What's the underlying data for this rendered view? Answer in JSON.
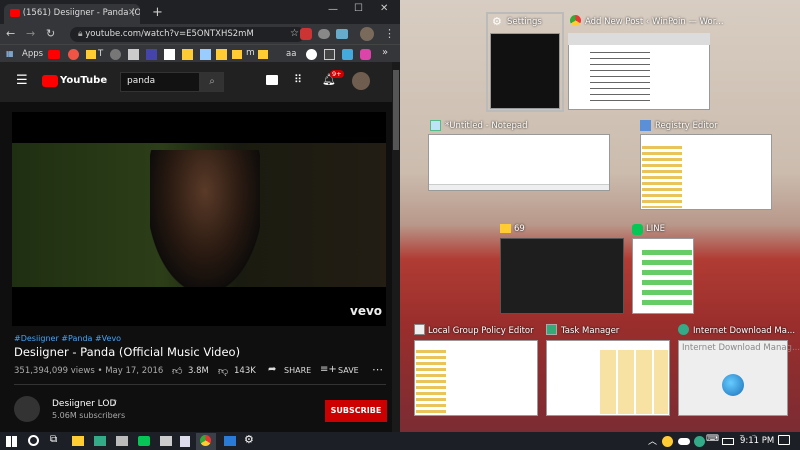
{
  "browser": {
    "tab_title": "(1561) Desiigner - Panda (Ofi",
    "address": "youtube.com/watch?v=E5ONTXHS2mM",
    "bookmarks_apps_label": "Apps",
    "bookmarks_more": "»",
    "bm_t": "T",
    "bm_m": "m",
    "bm_aa": "aa"
  },
  "youtube": {
    "logo_text": "YouTube",
    "search_value": "panda",
    "notifications_badge": "9+",
    "hashtags": "#Desiigner #Panda #Vevo",
    "video_title": "Desiigner - Panda (Official Music Video)",
    "views_date": "351,394,099 views • May 17, 2016",
    "likes": "3.8M",
    "dislikes": "143K",
    "share_label": "SHARE",
    "save_label": "SAVE",
    "channel_name": "Desiigner LOD",
    "subscribers": "5.06M subscribers",
    "subscribe_label": "SUBSCRIBE",
    "vevo_label": "vevo"
  },
  "task_view": {
    "windows": [
      {
        "title": "Settings"
      },
      {
        "title": "Add New Post ‹ WinPoin — Wor..."
      },
      {
        "title": "*Untitled - Notepad"
      },
      {
        "title": "Registry Editor"
      },
      {
        "title": "69"
      },
      {
        "title": "LINE"
      },
      {
        "title": "Local Group Policy Editor"
      },
      {
        "title": "Task Manager"
      },
      {
        "title": "Internet Download Ma..."
      }
    ],
    "idm_thumb_text": "Internet Download Manag..."
  },
  "taskbar": {
    "time": "9:11 PM"
  },
  "colors": {
    "youtube_red": "#ff0000",
    "subscribe_red": "#cc0000",
    "link_blue": "#3ea6ff"
  }
}
